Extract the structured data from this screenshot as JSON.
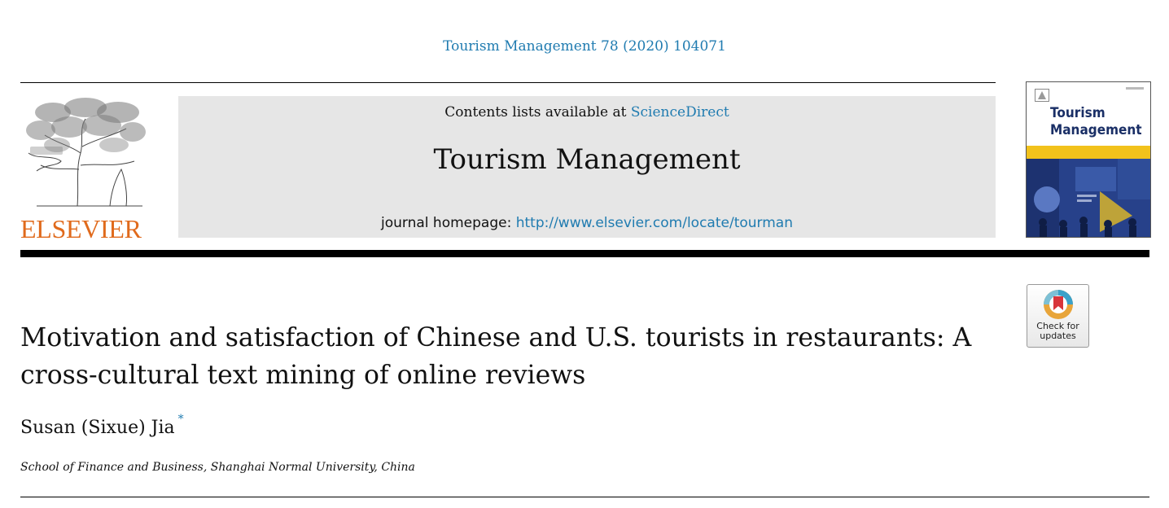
{
  "header": {
    "citation": "Tourism Management 78 (2020) 104071",
    "contents_prefix": "Contents lists available at ",
    "contents_link": "ScienceDirect",
    "journal_title": "Tourism Management",
    "homepage_prefix": "journal homepage: ",
    "homepage_url": "http://www.elsevier.com/locate/tourman"
  },
  "publisher": {
    "name": "ELSEVIER",
    "logo_icon": "elsevier-tree-icon",
    "color": "#e06a1c"
  },
  "cover": {
    "title_line1": "Tourism",
    "title_line2": "Management",
    "colors": {
      "title": "#1a2f66",
      "band": "#f2c21b",
      "photo": "#27418a"
    }
  },
  "check_updates": {
    "line1": "Check for",
    "line2": "updates",
    "icon": "crossmark-icon"
  },
  "article": {
    "title_line1": "Motivation and satisfaction of Chinese and U.S. tourists in restaurants: A",
    "title_line2": "cross-cultural text mining of online reviews",
    "author": "Susan (Sixue) Jia",
    "author_mark": "*",
    "affiliation": "School of Finance and Business, Shanghai Normal University, China"
  },
  "colors": {
    "link": "#1f7bb0",
    "banner_bg": "#e6e6e6"
  }
}
